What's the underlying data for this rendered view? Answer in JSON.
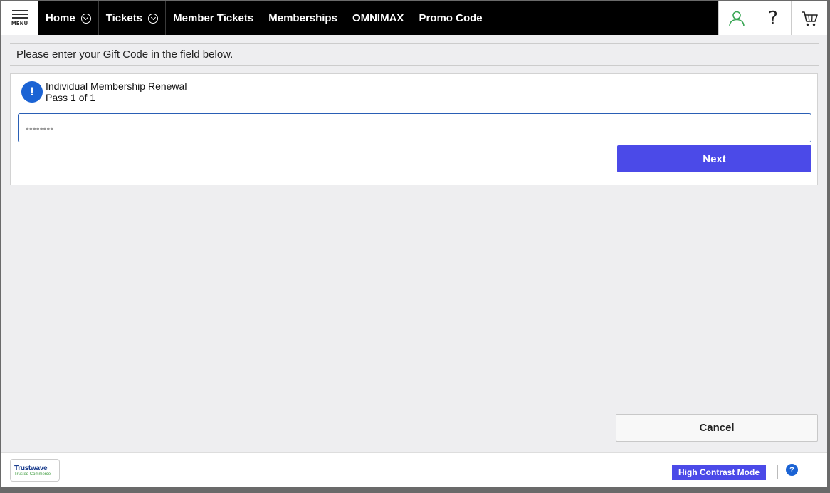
{
  "nav": {
    "menu_label": "MENU",
    "items": [
      {
        "label": "Home",
        "has_dropdown": true
      },
      {
        "label": "Tickets",
        "has_dropdown": true
      },
      {
        "label": "Member Tickets",
        "has_dropdown": false
      },
      {
        "label": "Memberships",
        "has_dropdown": false
      },
      {
        "label": "OMNIMAX",
        "has_dropdown": false
      },
      {
        "label": "Promo Code",
        "has_dropdown": false
      }
    ],
    "icons": [
      "account-icon",
      "help-icon",
      "cart-icon"
    ],
    "help_glyph": "?"
  },
  "instruction": "Please enter your Gift Code in the field below.",
  "pass_card": {
    "info_glyph": "!",
    "title": "Individual Membership Renewal",
    "subtitle": "Pass 1 of 1",
    "gift_code_value": "••••••••",
    "next_label": "Next"
  },
  "cancel_label": "Cancel",
  "footer": {
    "trust_badge_name": "Trustwave",
    "trust_badge_sub": "Trusted Commerce",
    "high_contrast_label": "High Contrast Mode",
    "help_glyph": "?"
  },
  "colors": {
    "nav_background": "#000000",
    "primary_button": "#4b4ae8",
    "info_blue": "#1b63d4",
    "account_icon": "#3aa655"
  }
}
